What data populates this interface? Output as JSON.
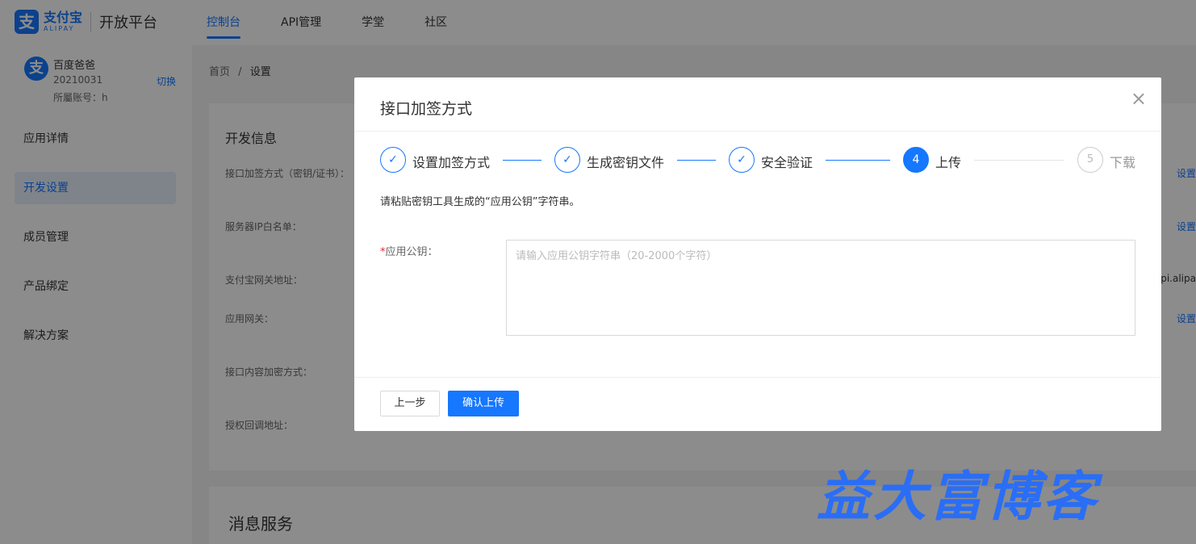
{
  "brand": {
    "icon": "zhi-logo-icon",
    "cn": "支付宝",
    "en": "ALIPAY",
    "platform": "开放平台",
    "color": "#1677ff"
  },
  "nav": {
    "items": [
      {
        "label": "控制台",
        "active": true
      },
      {
        "label": "API管理",
        "active": false
      },
      {
        "label": "学堂",
        "active": false
      },
      {
        "label": "社区",
        "active": false
      }
    ]
  },
  "account": {
    "name": "百度爸爸",
    "id": "20210031",
    "switch_label": "切换",
    "main_account": "所屬账号：h"
  },
  "sidebar": {
    "items": [
      {
        "label": "应用详情",
        "active": false
      },
      {
        "label": "开发设置",
        "active": true
      },
      {
        "label": "成员管理",
        "active": false
      },
      {
        "label": "产品绑定",
        "active": false
      },
      {
        "label": "解决方案",
        "active": false
      }
    ]
  },
  "breadcrumb": {
    "home": "首页",
    "separator": "/",
    "current": "设置"
  },
  "dev_info": {
    "title": "开发信息",
    "fields": [
      {
        "label": "接口加签方式（密钥/证书）：",
        "right": "设置",
        "kind": "link"
      },
      {
        "label": "服务器IP白名单：",
        "right": "设置",
        "kind": "link"
      },
      {
        "label": "支付宝网关地址：",
        "right": "api.alipa",
        "kind": "text"
      },
      {
        "label": "应用网关：",
        "right": "设置",
        "kind": "link"
      },
      {
        "label": "接口内容加密方式：",
        "right": "",
        "kind": "text"
      },
      {
        "label": "授权回调地址：",
        "right": "",
        "kind": "text"
      }
    ]
  },
  "message_service": {
    "title": "消息服务"
  },
  "modal": {
    "title": "接口加签方式",
    "close_icon": "close-icon",
    "steps": [
      {
        "label": "设置加签方式",
        "status": "done",
        "marker": "✓"
      },
      {
        "label": "生成密钥文件",
        "status": "done",
        "marker": "✓"
      },
      {
        "label": "安全验证",
        "status": "done",
        "marker": "✓"
      },
      {
        "label": "上传",
        "status": "active",
        "marker": "4"
      },
      {
        "label": "下载",
        "status": "wait",
        "marker": "5"
      }
    ],
    "tip": "请粘贴密钥工具生成的“应用公钥”字符串。",
    "field": {
      "required_mark": "*",
      "label": "应用公钥：",
      "value": "",
      "placeholder": "请输入应用公钥字符串（20-2000个字符）"
    },
    "buttons": {
      "prev": "上一步",
      "confirm": "确认上传"
    }
  },
  "watermark": "益大富博客"
}
